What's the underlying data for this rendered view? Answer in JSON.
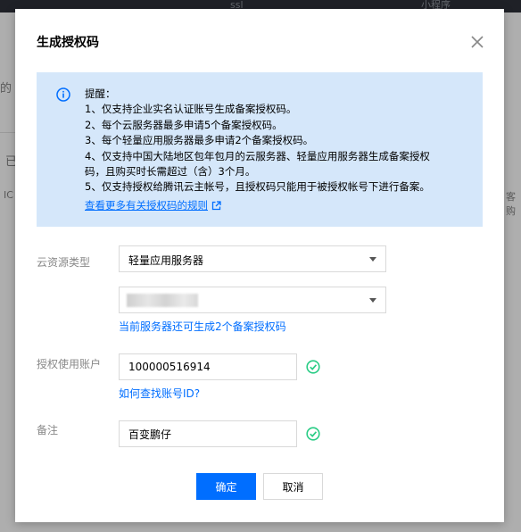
{
  "background": {
    "topbar_texts": [
      "ssl",
      "小程序"
    ],
    "side_texts": [
      "的",
      "已",
      "IC",
      "客购"
    ]
  },
  "dialog": {
    "title": "生成授权码",
    "notice": {
      "heading": "提醒：",
      "lines": [
        "1、仅支持企业实名认证账号生成备案授权码。",
        "2、每个云服务器最多申请5个备案授权码。",
        "3、每个轻量应用服务器最多申请2个备案授权码。",
        "4、仅支持中国大陆地区包年包月的云服务器、轻量应用服务器生成备案授权",
        "码，且购买时长需超过（含）3个月。",
        "5、仅支持授权给腾讯云主帐号，且授权码只能用于被授权帐号下进行备案。"
      ],
      "link": "查看更多有关授权码的规则"
    },
    "form": {
      "resource_type": {
        "label": "云资源类型",
        "value": "轻量应用服务器"
      },
      "instance_hint": "当前服务器还可生成2个备案授权码",
      "account": {
        "label": "授权使用账户",
        "value": "100000516914",
        "help_link": "如何查找账号ID?"
      },
      "remark": {
        "label": "备注",
        "value": "百变鹏仔"
      }
    },
    "buttons": {
      "confirm": "确定",
      "cancel": "取消"
    }
  },
  "colors": {
    "accent": "#006eff",
    "success": "#29cc85",
    "notice_bg": "#d5e7fa"
  }
}
